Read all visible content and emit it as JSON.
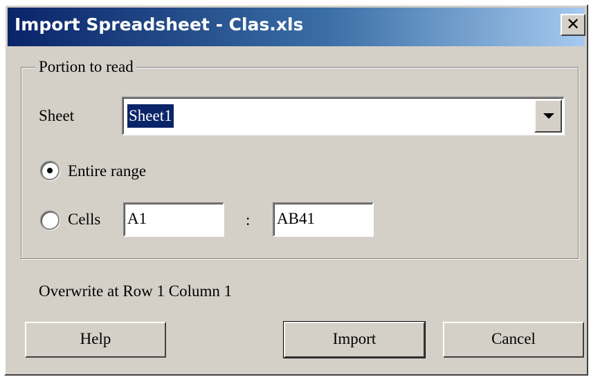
{
  "window": {
    "title": "Import Spreadsheet - Clas.xls",
    "close_label": "✕"
  },
  "portion": {
    "legend": "Portion to read",
    "sheet_label": "Sheet",
    "sheet_value": "Sheet1",
    "entire_range_label": "Entire range",
    "entire_range_selected": true,
    "cells_label": "Cells",
    "cells_selected": false,
    "cell_from": "A1",
    "range_separator": ":",
    "cell_to": "AB41"
  },
  "overwrite_text": "Overwrite at Row 1 Column 1",
  "buttons": {
    "help": "Help",
    "import": "Import",
    "cancel": "Cancel"
  },
  "colors": {
    "titlebar_start": "#0a246a",
    "titlebar_end": "#a6caf0",
    "dialog_face": "#d4d0c8",
    "selection": "#0a246a"
  },
  "icons": {
    "close": "close-icon",
    "dropdown": "chevron-down-icon"
  }
}
